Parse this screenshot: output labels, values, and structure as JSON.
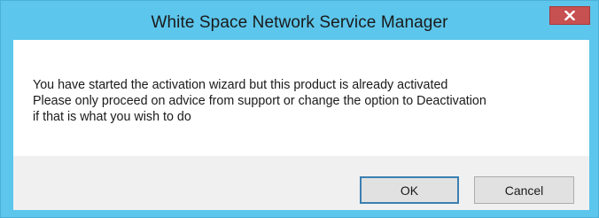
{
  "window": {
    "title": "White Space Network Service Manager",
    "close_icon": "close-icon",
    "colors": {
      "frame": "#5cc6ec",
      "close_button": "#c75050",
      "client": "#ffffff",
      "footer": "#f0f0f0",
      "default_button_border": "#3c7fb1"
    }
  },
  "dialog": {
    "message_lines": [
      "You have started the activation wizard but this product is already activated",
      "Please only proceed on advice from support or change the option to Deactivation",
      "if that is what you wish to do"
    ],
    "buttons": {
      "ok_label": "OK",
      "cancel_label": "Cancel"
    }
  }
}
